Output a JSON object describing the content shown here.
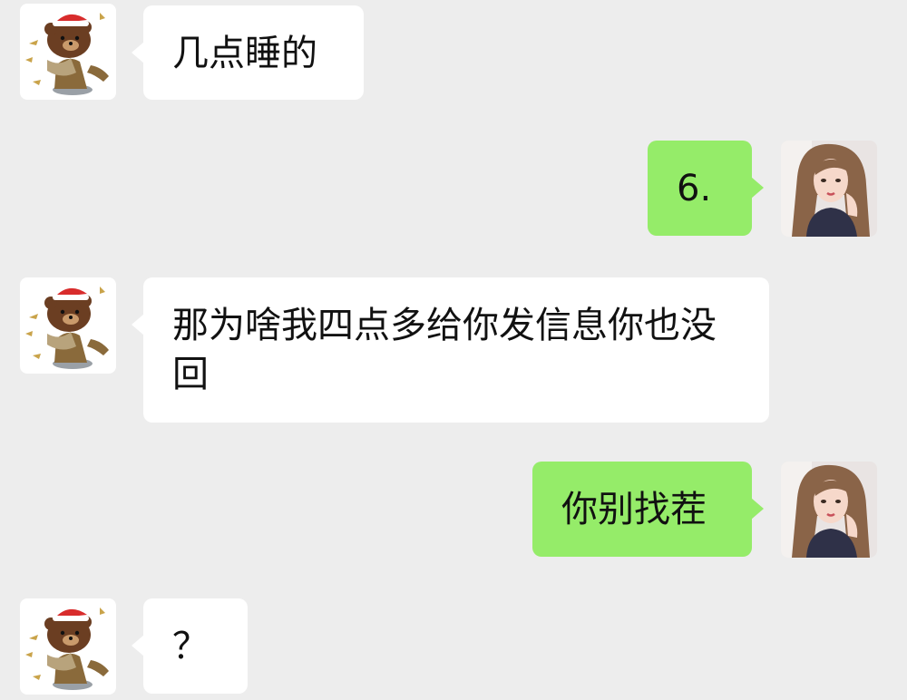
{
  "chat": {
    "messages": [
      {
        "sender": "bear",
        "text": "几点睡的"
      },
      {
        "sender": "girl",
        "text": "6."
      },
      {
        "sender": "bear",
        "text": "那为啥我四点多给你发信息你也没回"
      },
      {
        "sender": "girl",
        "text": "你别找茬"
      },
      {
        "sender": "bear",
        "text": "？"
      }
    ]
  },
  "colors": {
    "background": "#ededed",
    "incoming_bubble": "#ffffff",
    "outgoing_bubble": "#95ec69"
  },
  "icons": {
    "incoming_avatar": "bear-santa-avatar",
    "outgoing_avatar": "girl-portrait-avatar"
  }
}
